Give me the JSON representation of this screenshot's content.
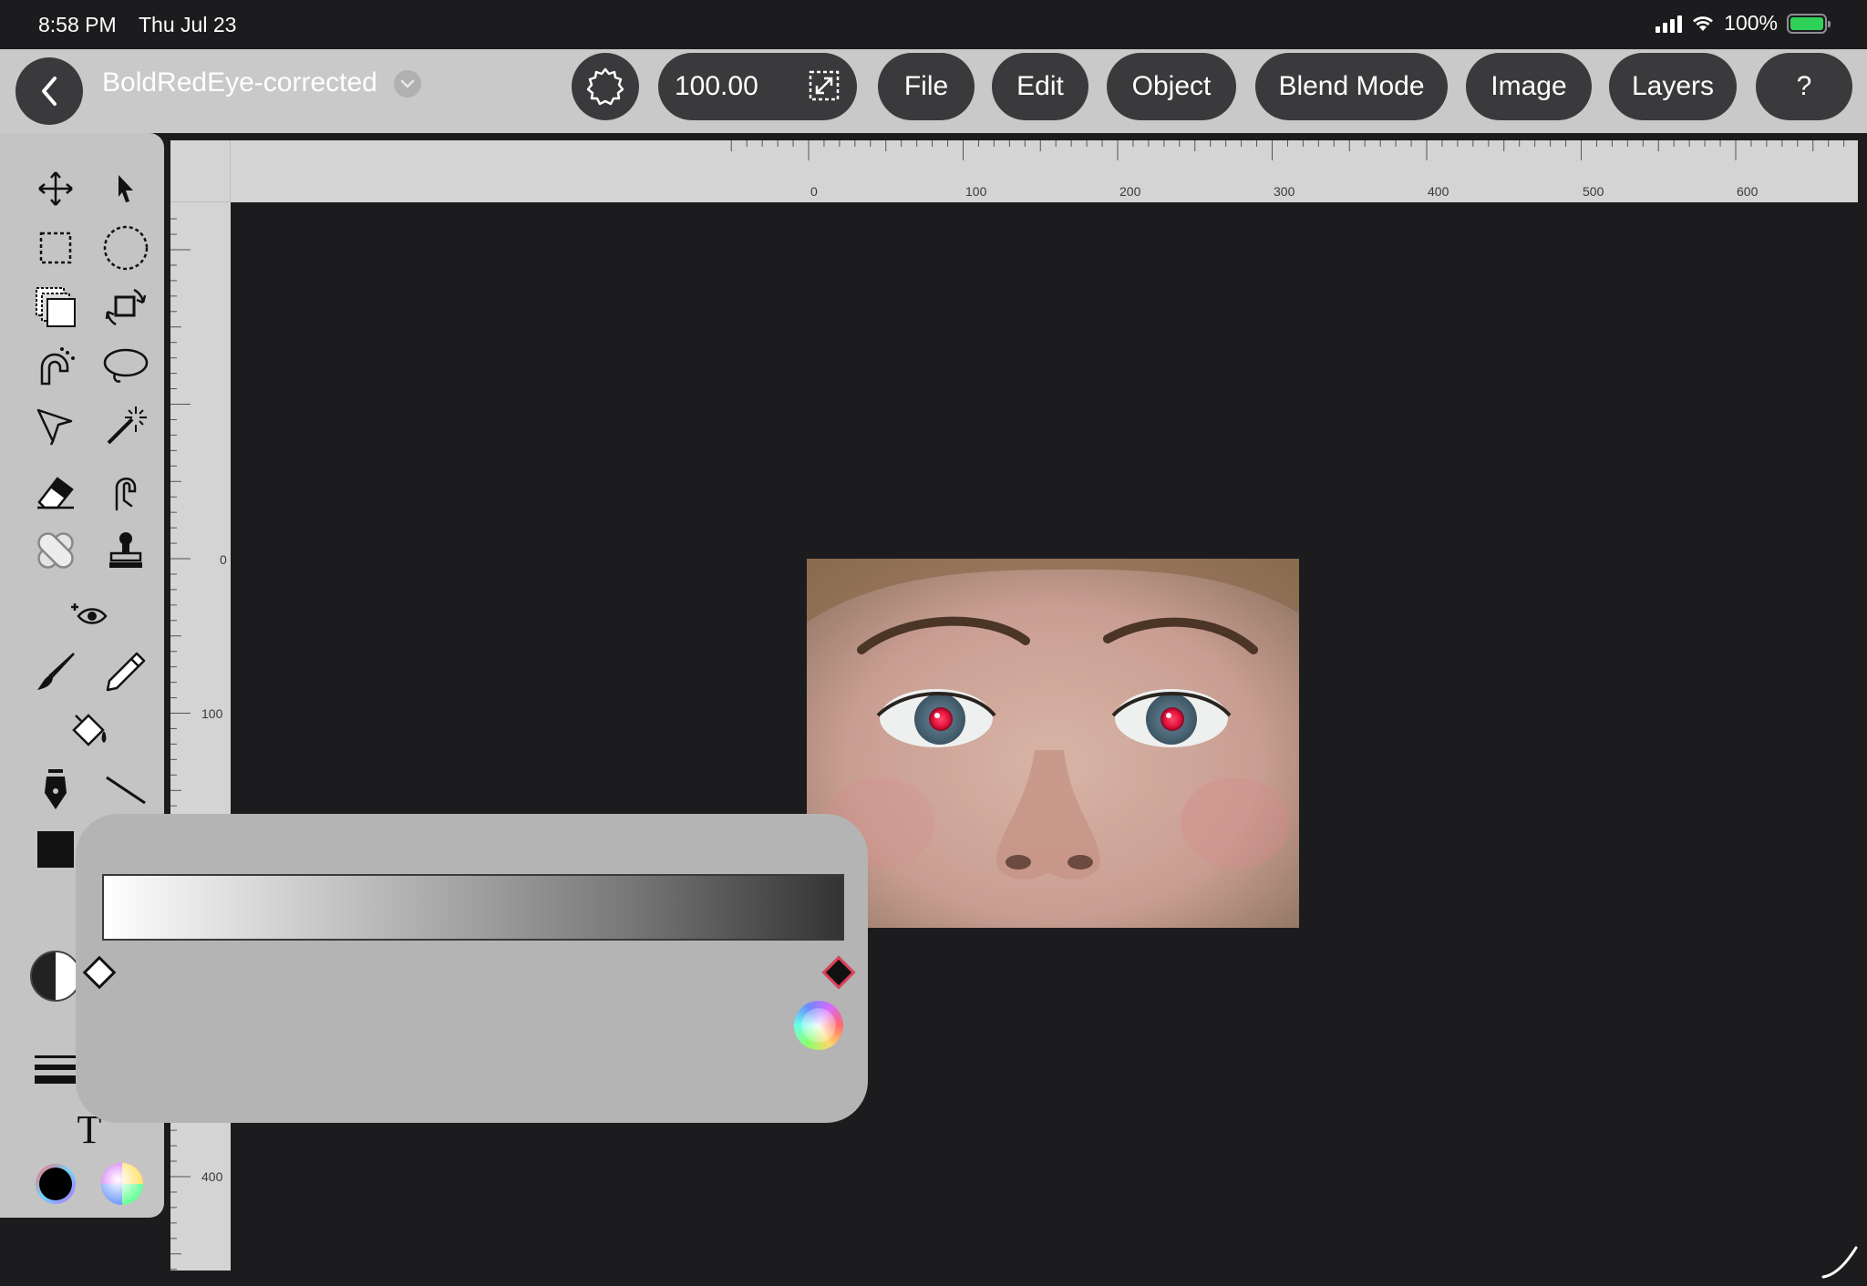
{
  "status_bar": {
    "time": "8:58 PM",
    "date": "Thu Jul 23",
    "battery": "100%"
  },
  "toolbar": {
    "document_title": "BoldRedEye-corrected",
    "zoom_value": "100.00",
    "menus": [
      {
        "label": "File"
      },
      {
        "label": "Edit"
      },
      {
        "label": "Object"
      },
      {
        "label": "Blend Mode"
      },
      {
        "label": "Image"
      },
      {
        "label": "Layers"
      },
      {
        "label": "?"
      }
    ]
  },
  "rulers": {
    "top_labels": [
      "0",
      "100",
      "200",
      "300",
      "400",
      "500",
      "600"
    ],
    "left_labels": [
      "0",
      "100",
      "400"
    ]
  },
  "tools": [
    "move-tool",
    "select-arrow-tool",
    "rect-marquee-tool",
    "ellipse-marquee-tool",
    "layer-select-tool",
    "transform-tool",
    "magnetic-lasso-tool",
    "lasso-tool",
    "polygon-lasso-tool",
    "magic-wand-tool",
    "eraser-tool",
    "smudge-tool",
    "healing-tool",
    "clone-stamp-tool",
    "red-eye-tool",
    "brush-tool",
    "pencil-tool",
    "fill-bucket-tool",
    "pen-tool",
    "line-tool",
    "shape-tool",
    "gradient-tool",
    "line-weight-tool",
    "text-tool"
  ],
  "text_tool_glyph": "T",
  "colors": {
    "foreground": "#000000",
    "accent_stop": "#e0405a",
    "panel": "#c4c4c4",
    "popup": "#b4b4b4",
    "pill": "#3a3a3c"
  },
  "gradient": {
    "stops": [
      "#ffffff",
      "#000000"
    ]
  }
}
